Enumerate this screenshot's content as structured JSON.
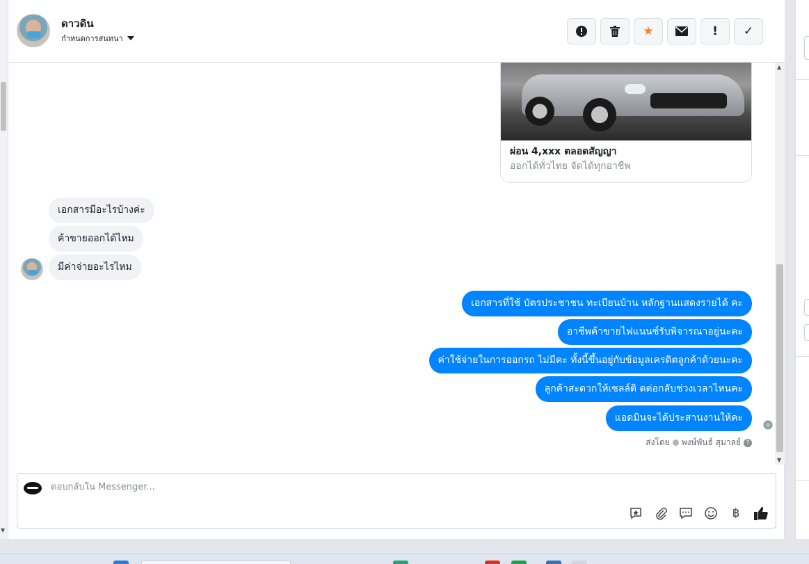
{
  "header": {
    "contact_name": "ดาวดิน",
    "assign_label": "กำหนดการสนทนา",
    "actions": [
      {
        "name": "report-button",
        "icon": "alert-circle-icon",
        "glyph": "!"
      },
      {
        "name": "delete-button",
        "icon": "trash-icon",
        "glyph": "🗑"
      },
      {
        "name": "star-button",
        "icon": "star-icon",
        "glyph": "★"
      },
      {
        "name": "mark-unread-button",
        "icon": "envelope-icon",
        "glyph": "✉"
      },
      {
        "name": "spam-button",
        "icon": "exclamation-icon",
        "glyph": "!"
      },
      {
        "name": "done-button",
        "icon": "check-icon",
        "glyph": "✓"
      }
    ]
  },
  "ad_card": {
    "title": "ผ่อน 4,xxx ตลอดสัญญา",
    "subtitle": "ออกได้ทั่วไทย จัดได้ทุกอาชีพ"
  },
  "messages_in": [
    "เอกสารมีอะไรบ้างค่ะ",
    "ค้าขายออกได้ไหม",
    "มีค่าจ่ายอะไรไหม"
  ],
  "messages_out": [
    "เอกสารที่ใช้ บัตรประชาชน ทะเบียนบ้าน หลักฐานแสดงรายได้ คะ",
    "อาชีพค้าขายไฟแนนซ์รับพิจารณาอยู่นะคะ",
    "ค่าใช้จ่ายในการออกรถ ไม่มีคะ ทั้งนี้ขึ้นอยู่กับข้อมูลเครดิตลูกค้าด้วยนะคะ",
    "ลูกค้าสะดวกให้เซลล์ติ ดต่อกลับช่วงเวลาไหนคะ",
    "แอดมินจะได้ประสานงานให้คะ"
  ],
  "sent_by": {
    "prefix": "ส่งโดย",
    "name": "พงษ์พันธ์ สุมาลย์"
  },
  "composer": {
    "placeholder": "ตอบกลับใน Messenger...",
    "tools": [
      "saved-reply-icon",
      "paperclip-icon",
      "chat-bubble-icon",
      "emoji-icon",
      "baht-icon",
      "thumbs-up-icon"
    ]
  },
  "colors": {
    "outgoing_bubble": "#0084ff",
    "incoming_bubble": "#f0f2f5",
    "star": "#f5822a"
  }
}
